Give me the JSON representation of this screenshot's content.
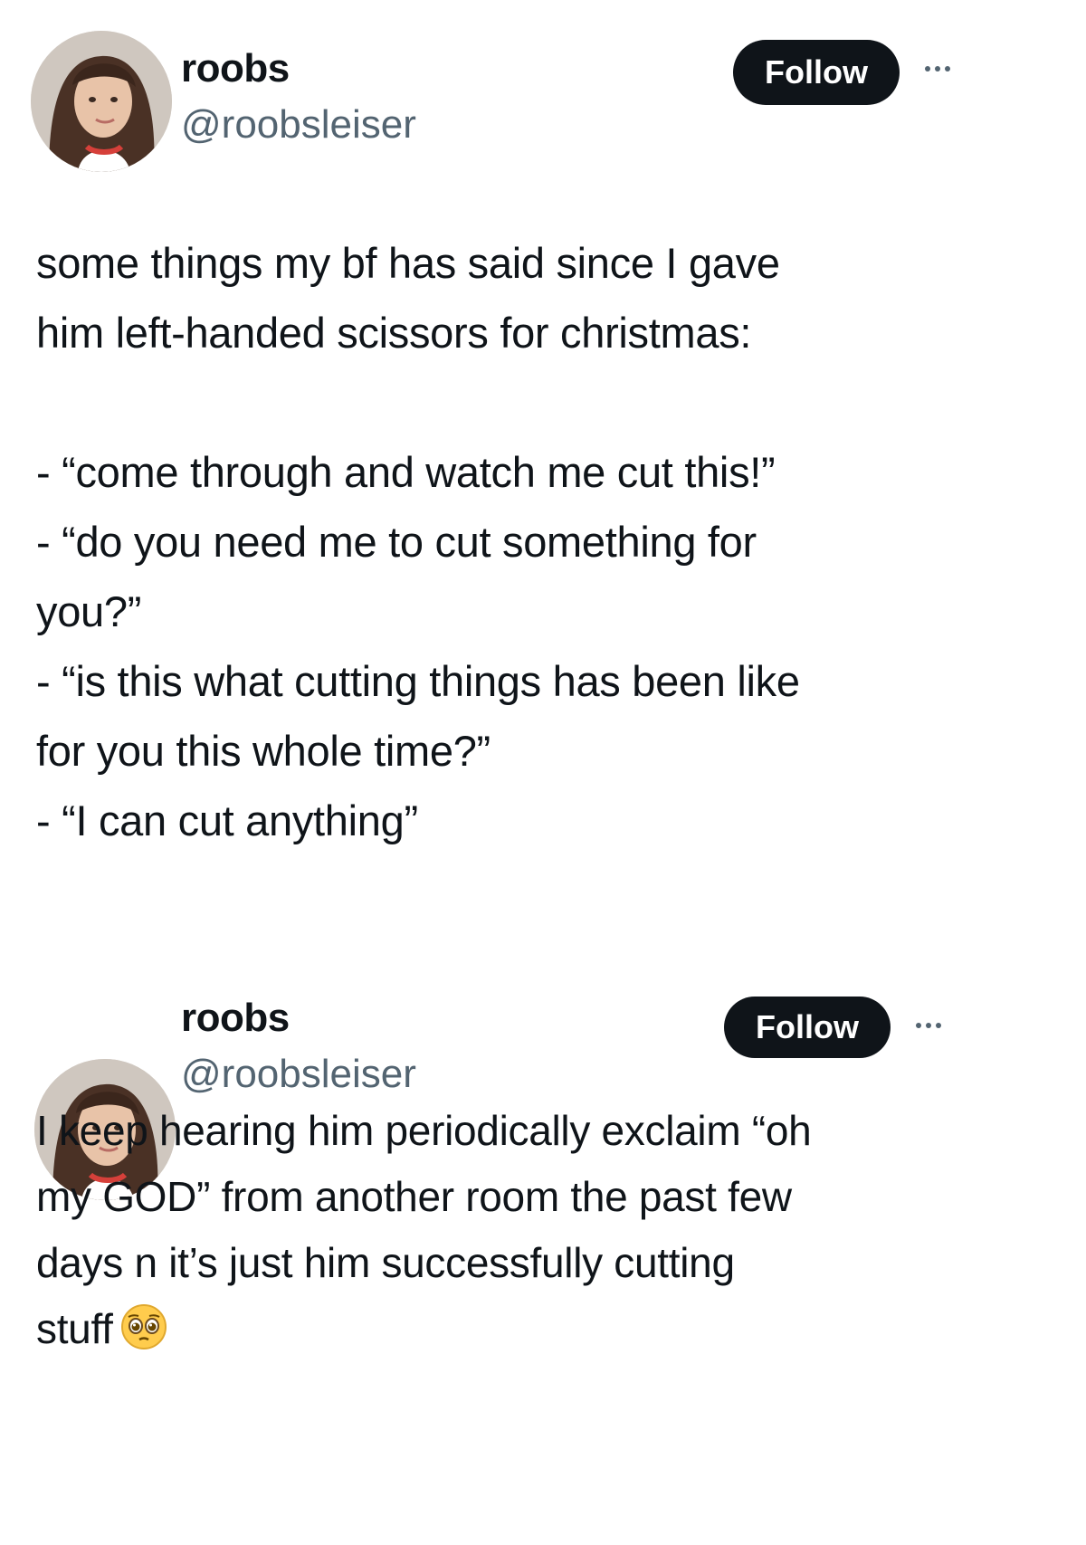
{
  "tweets": [
    {
      "display_name": "roobs",
      "handle": "@roobsleiser",
      "follow_label": "Follow",
      "intro_lines": [
        "some things my bf has said since I gave",
        "him left-handed scissors for christmas:"
      ],
      "quote_lines": [
        "- “come through and watch me cut this!”",
        "- “do you need me to cut something for",
        "you?”",
        "- “is this what cutting things has been like",
        "for you this whole time?”",
        "- “I can cut anything”"
      ]
    },
    {
      "display_name": "roobs",
      "handle": "@roobsleiser",
      "follow_label": "Follow",
      "body_lines": [
        "I keep hearing him periodically exclaim “oh",
        "my GOD” from another room the past few",
        "days n it’s just him successfully cutting",
        "stuff"
      ],
      "emoji": "pleading-face-emoji"
    }
  ],
  "icons": {
    "avatar": "profile-photo",
    "more": "more-options-icon"
  },
  "colors": {
    "follow_bg": "#0f1419",
    "secondary_text": "#536471"
  }
}
